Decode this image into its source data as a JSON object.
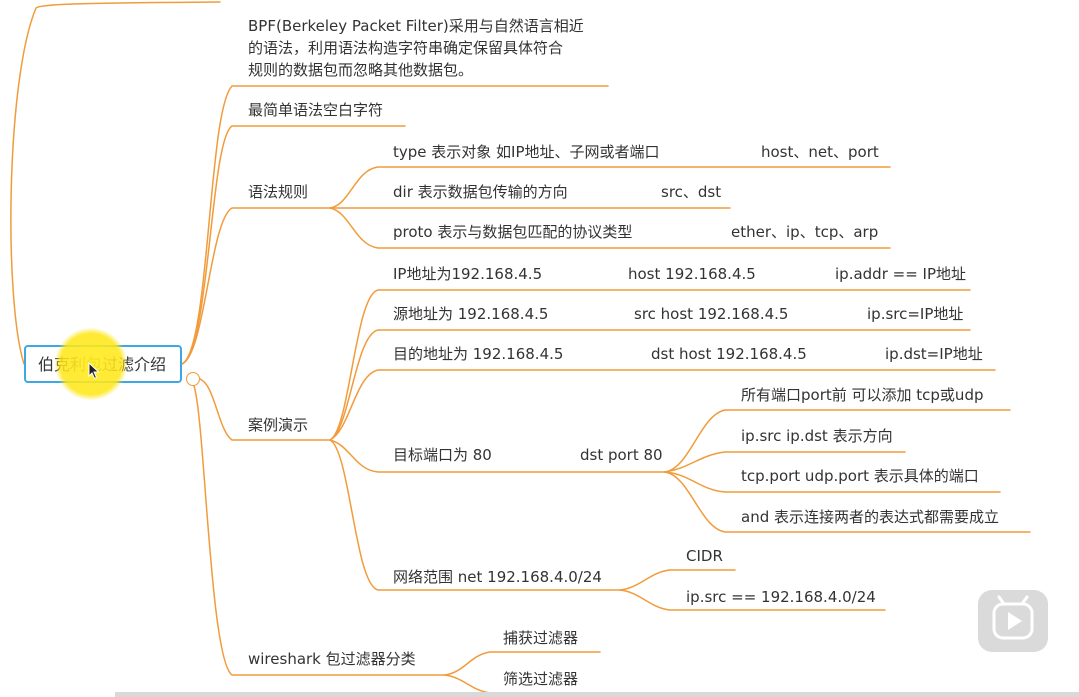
{
  "colors": {
    "branch": "#f19b3b",
    "root_border": "#3ea8e5",
    "cursor": "#ffe828"
  },
  "root": {
    "label": "伯克利包过滤介绍"
  },
  "intro": {
    "line1": "BPF(Berkeley Packet Filter)采用与自然语言相近",
    "line2": "的语法，利用语法构造字符串确定保留具体符合",
    "line3": "规则的数据包而忽略其他数据包。"
  },
  "simplest": "最简单语法空白字符",
  "syntax": {
    "label": "语法规则",
    "items": [
      {
        "text": "type 表示对象 如IP地址、子网或者端口",
        "value": "host、net、port"
      },
      {
        "text": "dir 表示数据包传输的方向",
        "value": "src、dst"
      },
      {
        "text": "proto 表示与数据包匹配的协议类型",
        "value": "ether、ip、tcp、arp"
      }
    ]
  },
  "cases": {
    "label": "案例演示",
    "rows": [
      {
        "desc": "IP地址为192.168.4.5",
        "capture": "host 192.168.4.5",
        "display": "ip.addr == IP地址"
      },
      {
        "desc": "源地址为 192.168.4.5",
        "capture": "src host 192.168.4.5",
        "display": "ip.src=IP地址"
      },
      {
        "desc": "目的地址为 192.168.4.5",
        "capture": "dst host 192.168.4.5",
        "display": "ip.dst=IP地址"
      }
    ],
    "port": {
      "desc": "目标端口为 80",
      "capture": "dst port 80",
      "notes": [
        "所有端口port前 可以添加 tcp或udp",
        "ip.src ip.dst 表示方向",
        "tcp.port udp.port 表示具体的端口",
        "and 表示连接两者的表达式都需要成立"
      ]
    },
    "net": {
      "desc": "网络范围 net 192.168.4.0/24",
      "notes": [
        "CIDR",
        "ip.src == 192.168.4.0/24"
      ]
    }
  },
  "wireshark": {
    "label": "wireshark 包过滤器分类",
    "items": [
      "捕获过滤器",
      "筛选过滤器"
    ]
  }
}
